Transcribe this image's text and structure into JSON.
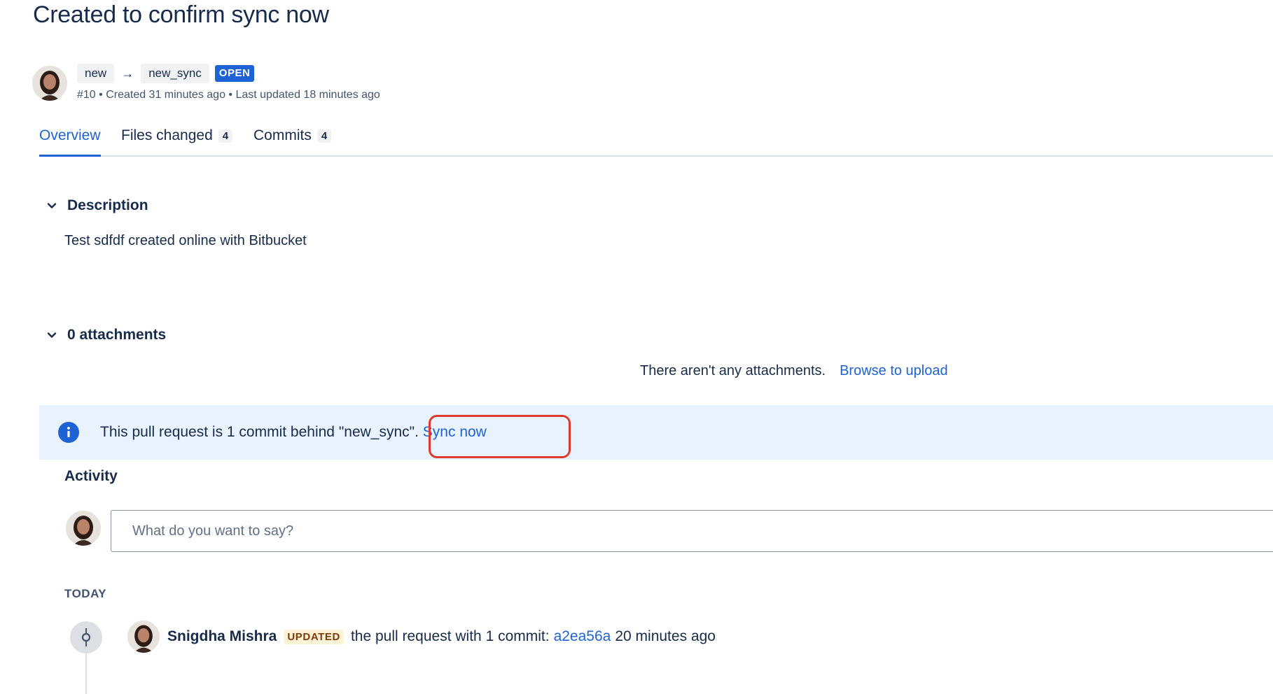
{
  "pr": {
    "title": "Created to confirm sync now",
    "source_branch": "new",
    "arrow": "→",
    "target_branch": "new_sync",
    "status": "OPEN",
    "meta": "#10 • Created 31 minutes ago • Last updated 18 minutes ago"
  },
  "tabs": [
    {
      "label": "Overview",
      "count": ""
    },
    {
      "label": "Files changed",
      "count": "4"
    },
    {
      "label": "Commits",
      "count": "4"
    }
  ],
  "description": {
    "heading": "Description",
    "text": "Test sdfdf created online with Bitbucket"
  },
  "attachments": {
    "heading": "0 attachments",
    "empty_text": "There aren't any attachments.",
    "browse_link": "Browse to upload"
  },
  "sync_banner": {
    "text": "This pull request is 1 commit behind \"new_sync\".",
    "link": "Sync now"
  },
  "activity": {
    "heading": "Activity",
    "comment_placeholder": "What do you want to say?",
    "day_label": "TODAY",
    "events": [
      {
        "author": "Snigdha Mishra",
        "badge": "UPDATED",
        "text": "the pull request with 1 commit:",
        "commit": "a2ea56a",
        "time": "20 minutes ago"
      }
    ]
  },
  "colors": {
    "link": "#1d63d6",
    "banner_bg": "#e9f2ff",
    "open_badge": "#1d63d6",
    "updated_badge_bg": "#fff3d6",
    "highlight": "#de3a2d"
  },
  "icons": [
    "chevron-down-icon",
    "info-icon",
    "commit-icon",
    "arrow-right-icon"
  ]
}
